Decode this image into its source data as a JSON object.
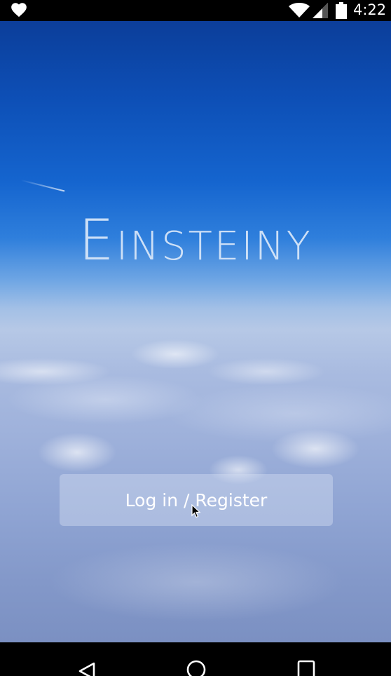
{
  "status_bar": {
    "time": "4:22",
    "icons": [
      "heart-icon",
      "wifi-icon",
      "cell-signal-icon",
      "battery-icon"
    ]
  },
  "app": {
    "title": "Einsteiny"
  },
  "actions": {
    "login_register_label": "Log in / Register"
  },
  "nav_bar": {
    "icons": [
      "back-icon",
      "home-icon",
      "recents-icon"
    ]
  },
  "colors": {
    "sky_top": "#0c3e9a",
    "sky_mid": "#2f7fdc",
    "clouds": "#a9bbe0",
    "button_bg": "rgba(215,224,244,0.42)",
    "text": "#ffffff"
  }
}
